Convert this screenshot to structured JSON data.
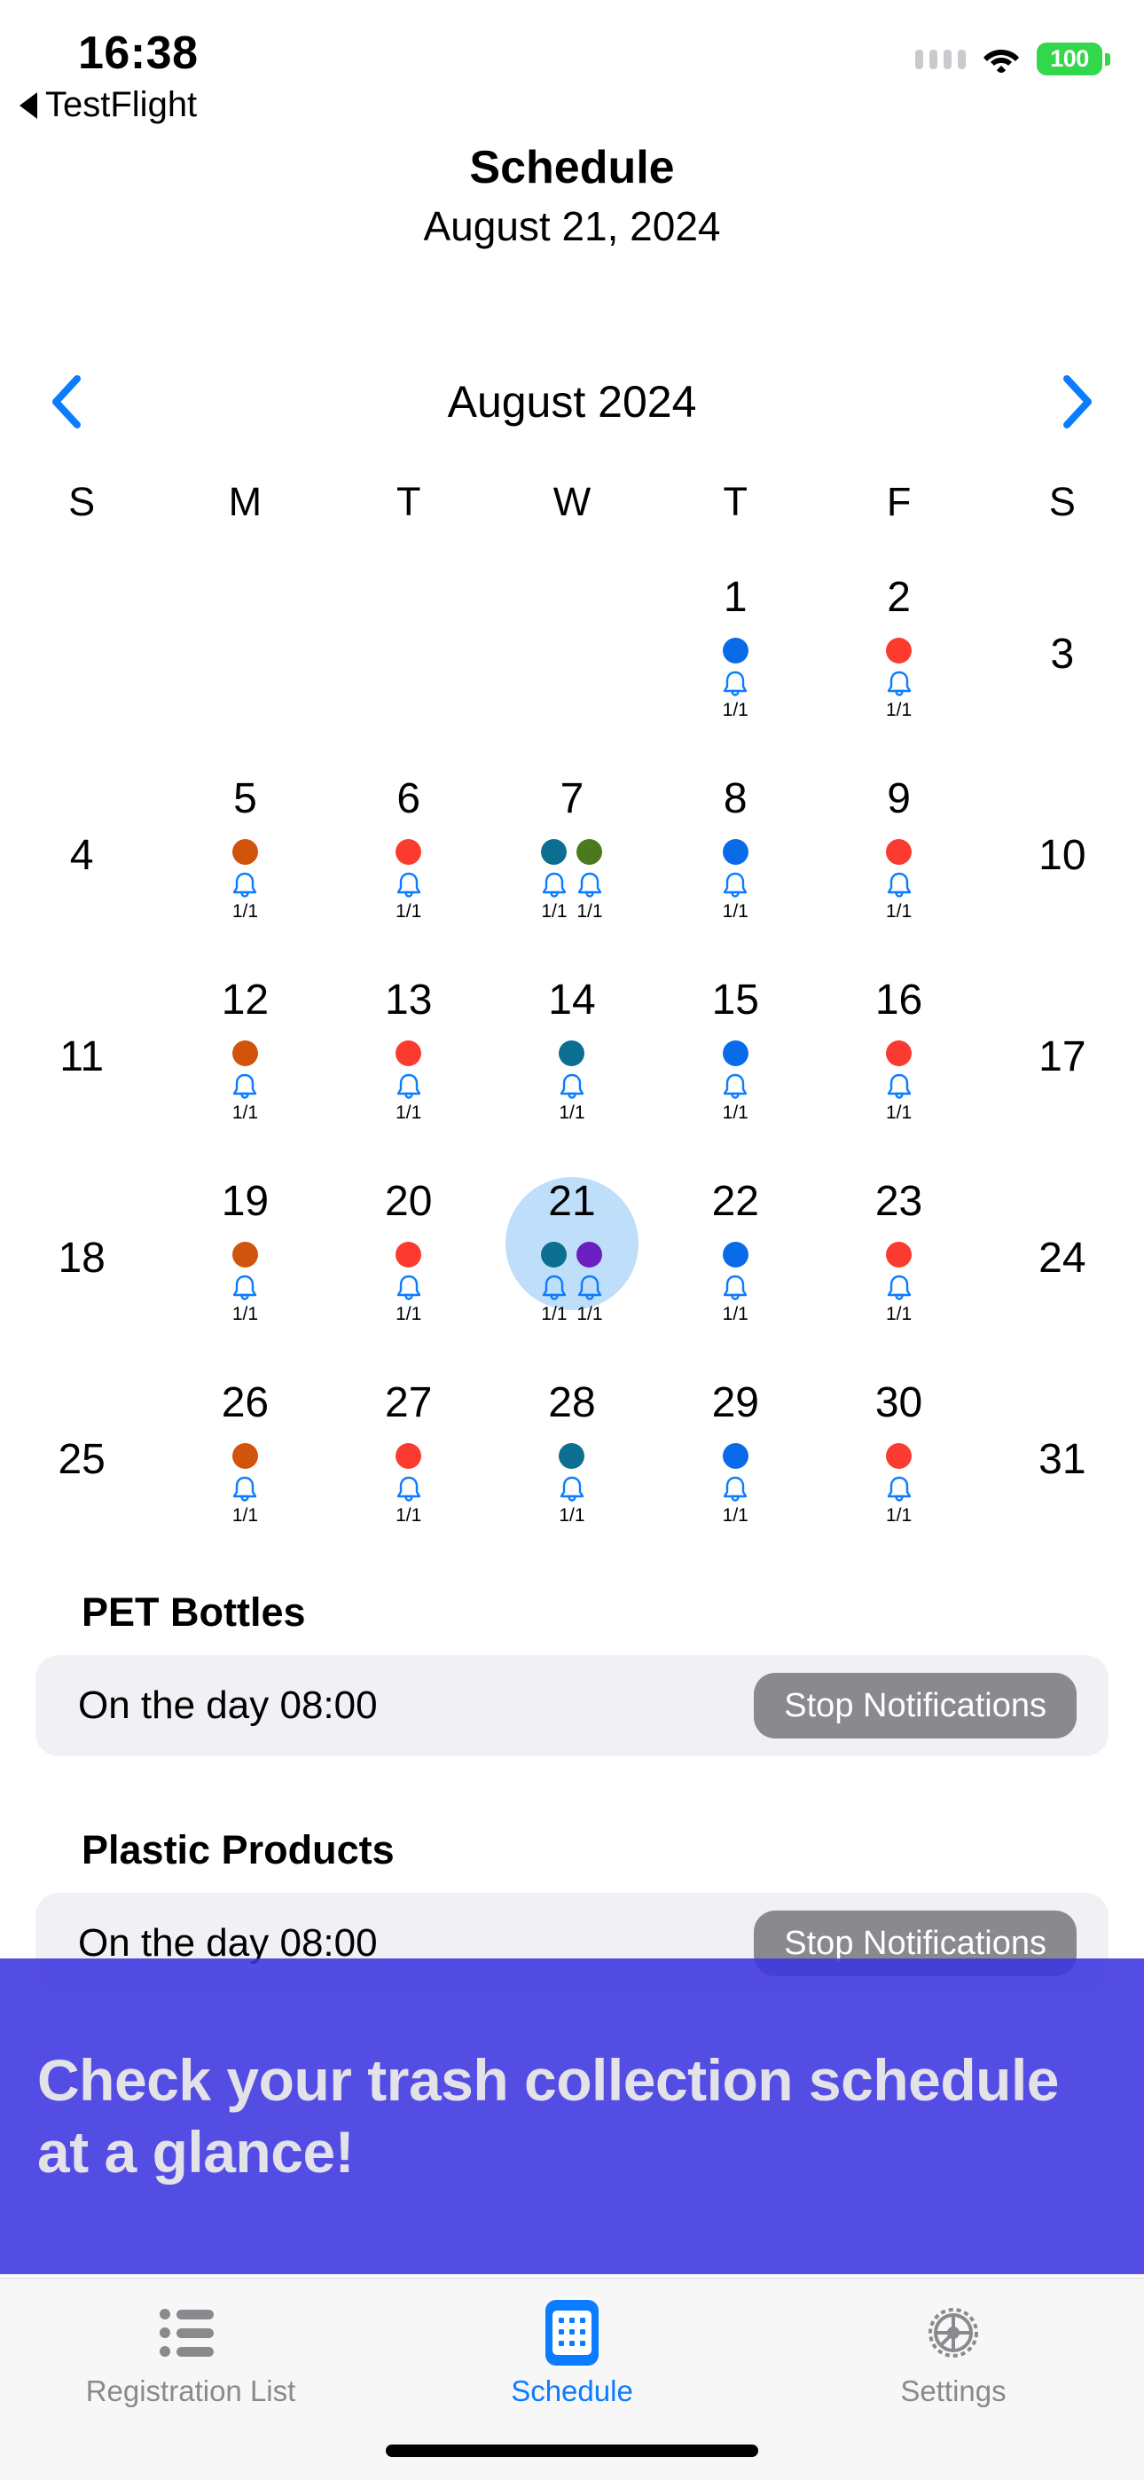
{
  "status_bar": {
    "time": "16:38",
    "battery_percent": "100",
    "battery_color": "#32D74B",
    "signal_icon": "signal-dots-icon",
    "wifi_icon": "wifi-icon",
    "battery_icon": "battery-icon"
  },
  "back_link": {
    "label": "TestFlight",
    "icon": "back-triangle-icon"
  },
  "nav": {
    "title": "Schedule",
    "subtitle": "August 21, 2024"
  },
  "month_bar": {
    "prev_icon": "chevron-left-icon",
    "next_icon": "chevron-right-icon",
    "label": "August 2024",
    "accent": "#0A7CFF"
  },
  "weekdays": [
    "S",
    "M",
    "T",
    "W",
    "T",
    "F",
    "S"
  ],
  "calendar": {
    "selected_day": "21",
    "selection_color": "#BFDEFA",
    "bell_icon": "bell-icon",
    "bell_color": "#0A7CFF",
    "weeks": [
      [
        {
          "day": "",
          "events": []
        },
        {
          "day": "",
          "events": []
        },
        {
          "day": "",
          "events": []
        },
        {
          "day": "",
          "events": []
        },
        {
          "day": "1",
          "events": [
            {
              "color": "#0A6BE8",
              "count": "1/1"
            }
          ]
        },
        {
          "day": "2",
          "events": [
            {
              "color": "#FB3B30",
              "count": "1/1"
            }
          ]
        },
        {
          "day": "3",
          "events": [],
          "weekend": true
        }
      ],
      [
        {
          "day": "4",
          "events": [],
          "weekend": true
        },
        {
          "day": "5",
          "events": [
            {
              "color": "#D2530B",
              "count": "1/1"
            }
          ]
        },
        {
          "day": "6",
          "events": [
            {
              "color": "#FB3B30",
              "count": "1/1"
            }
          ]
        },
        {
          "day": "7",
          "events": [
            {
              "color": "#0C6E91",
              "count": "1/1"
            },
            {
              "color": "#4B7A1E",
              "count": "1/1"
            }
          ]
        },
        {
          "day": "8",
          "events": [
            {
              "color": "#0A6BE8",
              "count": "1/1"
            }
          ]
        },
        {
          "day": "9",
          "events": [
            {
              "color": "#FB3B30",
              "count": "1/1"
            }
          ]
        },
        {
          "day": "10",
          "events": [],
          "weekend": true
        }
      ],
      [
        {
          "day": "11",
          "events": [],
          "weekend": true
        },
        {
          "day": "12",
          "events": [
            {
              "color": "#D2530B",
              "count": "1/1"
            }
          ]
        },
        {
          "day": "13",
          "events": [
            {
              "color": "#FB3B30",
              "count": "1/1"
            }
          ]
        },
        {
          "day": "14",
          "events": [
            {
              "color": "#0C6E91",
              "count": "1/1"
            }
          ]
        },
        {
          "day": "15",
          "events": [
            {
              "color": "#0A6BE8",
              "count": "1/1"
            }
          ]
        },
        {
          "day": "16",
          "events": [
            {
              "color": "#FB3B30",
              "count": "1/1"
            }
          ]
        },
        {
          "day": "17",
          "events": [],
          "weekend": true
        }
      ],
      [
        {
          "day": "18",
          "events": [],
          "weekend": true
        },
        {
          "day": "19",
          "events": [
            {
              "color": "#D2530B",
              "count": "1/1"
            }
          ]
        },
        {
          "day": "20",
          "events": [
            {
              "color": "#FB3B30",
              "count": "1/1"
            }
          ]
        },
        {
          "day": "21",
          "events": [
            {
              "color": "#0C6E91",
              "count": "1/1"
            },
            {
              "color": "#6A1FBF",
              "count": "1/1"
            }
          ],
          "selected": true
        },
        {
          "day": "22",
          "events": [
            {
              "color": "#0A6BE8",
              "count": "1/1"
            }
          ]
        },
        {
          "day": "23",
          "events": [
            {
              "color": "#FB3B30",
              "count": "1/1"
            }
          ]
        },
        {
          "day": "24",
          "events": [],
          "weekend": true
        }
      ],
      [
        {
          "day": "25",
          "events": [],
          "weekend": true
        },
        {
          "day": "26",
          "events": [
            {
              "color": "#D2530B",
              "count": "1/1"
            }
          ]
        },
        {
          "day": "27",
          "events": [
            {
              "color": "#FB3B30",
              "count": "1/1"
            }
          ]
        },
        {
          "day": "28",
          "events": [
            {
              "color": "#0C6E91",
              "count": "1/1"
            }
          ]
        },
        {
          "day": "29",
          "events": [
            {
              "color": "#0A6BE8",
              "count": "1/1"
            }
          ]
        },
        {
          "day": "30",
          "events": [
            {
              "color": "#FB3B30",
              "count": "1/1"
            }
          ]
        },
        {
          "day": "31",
          "events": [],
          "weekend": true
        }
      ]
    ]
  },
  "schedule_sections": [
    {
      "title": "PET Bottles",
      "time_label": "On the day 08:00",
      "button_label": "Stop Notifications"
    },
    {
      "title": "Plastic Products",
      "time_label": "On the day 08:00",
      "button_label": "Stop Notifications"
    }
  ],
  "promo": {
    "text": "Check your trash collection schedule at a glance!",
    "background": "#3C34E0",
    "text_color": "#E2E2E8"
  },
  "tabs": [
    {
      "label": "Registration List",
      "icon": "list-icon",
      "active": false
    },
    {
      "label": "Schedule",
      "icon": "calendar-keypad-icon",
      "active": true
    },
    {
      "label": "Settings",
      "icon": "gear-icon",
      "active": false
    }
  ]
}
